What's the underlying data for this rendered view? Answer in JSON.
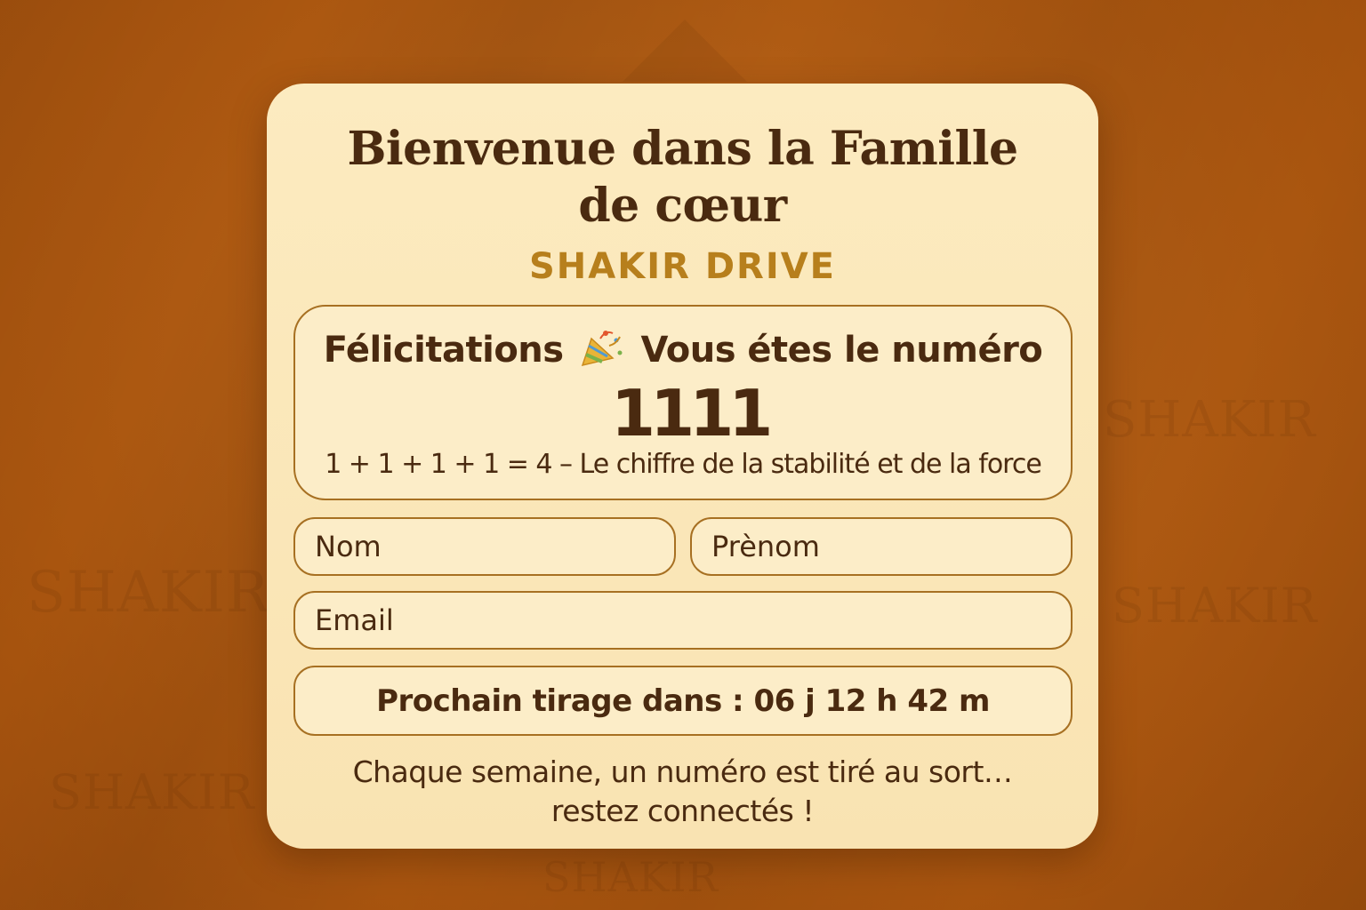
{
  "background": {
    "color": "#b35e14",
    "watermark_text": [
      "SHAKIR",
      "SHAKIR",
      "SHAKIR",
      "SHAKIR",
      "SHAKIR"
    ]
  },
  "card": {
    "title_line1": "Bienvenue dans la Famille",
    "title_line2": "de cœur",
    "brand": "SHAKIR DRIVE",
    "brand_color": "#b77f1c",
    "text_color": "#4a2a10",
    "border_color": "#a77022"
  },
  "congrats": {
    "lead": "Félicitations",
    "icon": "party-popper-icon",
    "tail": "Vous étes le numéro",
    "number": "1111",
    "explanation": "1 + 1 + 1 + 1 = 4 – Le chiffre de la stabilité et de la force"
  },
  "form": {
    "nom_placeholder": "Nom",
    "prenom_placeholder": "Prènom",
    "email_placeholder": "Email"
  },
  "countdown": {
    "label": "Prochain tirage dans : 06 j 12 h 42 m"
  },
  "footer": {
    "line1": "Chaque semaine, un numéro est tiré au sort…",
    "line2": "restez connectés !"
  }
}
